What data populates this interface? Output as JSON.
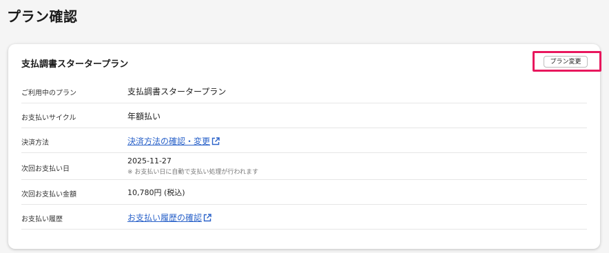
{
  "page": {
    "title": "プラン確認"
  },
  "card": {
    "title": "支払調書スタータープラン",
    "change_button_label": "プラン変更",
    "highlight_color": "#e8175d"
  },
  "rows": [
    {
      "label": "ご利用中のプラン",
      "value": "支払調書スタータープラン"
    },
    {
      "label": "お支払いサイクル",
      "value": "年額払い"
    },
    {
      "label": "決済方法",
      "value": "決済方法の確認・変更",
      "is_link": true,
      "icon": "external-link-icon"
    },
    {
      "label": "次回お支払い日",
      "value": "2025-11-27",
      "note": "※ お支払い日に自動で支払い処理が行われます"
    },
    {
      "label": "次回お支払い金額",
      "value": "10,780円 (税込)"
    },
    {
      "label": "お支払い履歴",
      "value": "お支払い履歴の確認",
      "is_link": true,
      "icon": "external-link-icon"
    }
  ],
  "colors": {
    "link": "#2a62c9",
    "background": "#f5f5f5",
    "card": "#ffffff"
  }
}
